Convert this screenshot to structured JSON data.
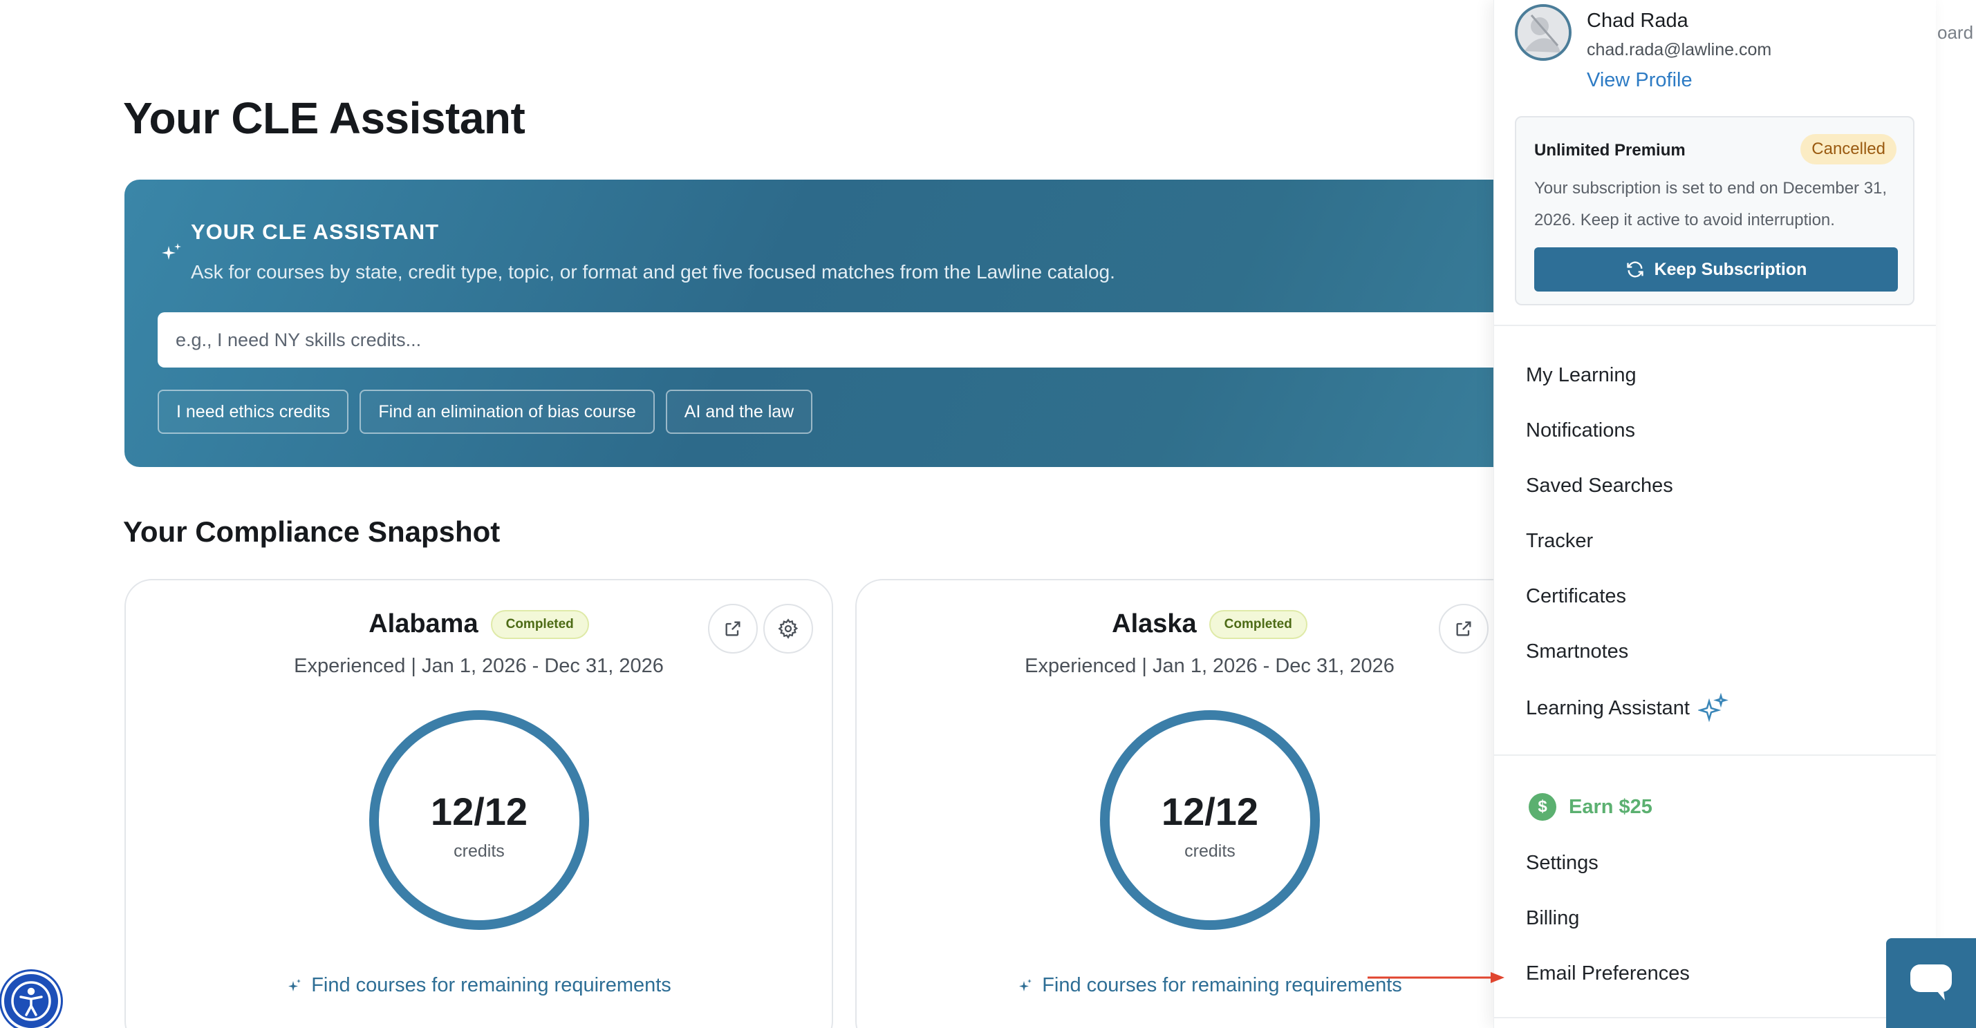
{
  "page": {
    "title": "Your CLE Assistant"
  },
  "hero": {
    "title": "YOUR CLE ASSISTANT",
    "subtitle": "Ask for courses by state, credit type, topic, or format and get five focused matches from the Lawline catalog.",
    "input_placeholder": "e.g., I need NY skills credits...",
    "chips": [
      "I need ethics credits",
      "Find an elimination of bias course",
      "AI and the law"
    ]
  },
  "snapshot": {
    "title": "Your Compliance Snapshot",
    "cards": [
      {
        "state": "Alabama",
        "badge": "Completed",
        "period": "Experienced | Jan 1, 2026 - Dec 31, 2026",
        "credits": "12/12",
        "credits_label": "credits",
        "link": "Find courses for remaining requirements"
      },
      {
        "state": "Alaska",
        "badge": "Completed",
        "period": "Experienced | Jan 1, 2026 - Dec 31, 2026",
        "credits": "12/12",
        "credits_label": "credits",
        "link": "Find courses for remaining requirements"
      }
    ]
  },
  "user": {
    "name": "Chad Rada",
    "email": "chad.rada@lawline.com",
    "view_profile": "View Profile"
  },
  "subscription": {
    "plan": "Unlimited Premium",
    "status": "Cancelled",
    "status_color": "#fbecc4",
    "message": "Your subscription is set to end on December 31, 2026. Keep it active to avoid interruption.",
    "button": "Keep Subscription"
  },
  "menu": {
    "primary": [
      "My Learning",
      "Notifications",
      "Saved Searches",
      "Tracker",
      "Certificates",
      "Smartnotes",
      "Learning Assistant"
    ],
    "earn": "Earn $25",
    "earn_symbol": "$",
    "secondary": [
      "Settings",
      "Billing",
      "Email Preferences"
    ]
  },
  "background_peek": "oard",
  "colors": {
    "accent": "#2e6f97",
    "ring": "#3b7ea8",
    "earn": "#5bb070",
    "annotation_arrow": "#e0452f"
  }
}
